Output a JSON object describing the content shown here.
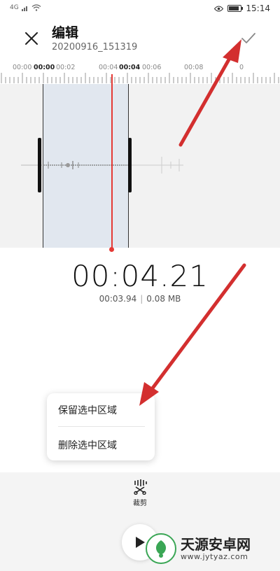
{
  "status_bar": {
    "signal_text": "4G",
    "time": "15:14",
    "battery_level": 0.85
  },
  "header": {
    "title": "编辑",
    "subtitle": "20200916_151319",
    "close_icon": "close-icon",
    "confirm_icon": "check-icon"
  },
  "ruler": {
    "labels": [
      "00:00",
      "00:00",
      "00:02",
      "00:04",
      "00:04",
      "00:06",
      "00:08",
      "0"
    ],
    "bold": [
      false,
      true,
      false,
      false,
      true,
      false,
      false,
      false
    ]
  },
  "playback": {
    "current_time": "00:04.21",
    "selected_duration": "00:03.94",
    "file_size": "0.08 MB"
  },
  "popup_menu": {
    "keep_selection": "保留选中区域",
    "delete_selection": "删除选中区域"
  },
  "bottom_bar": {
    "trim_label": "裁剪",
    "trim_icon": "scissors-icon",
    "play_icon": "play-icon"
  },
  "watermark": {
    "title": "天源安卓网",
    "url": "www.jytyaz.com"
  },
  "colors": {
    "accent_red": "#e53935",
    "selection_bg": "#e1e7ef",
    "wave_bg": "#f2f2f2"
  }
}
